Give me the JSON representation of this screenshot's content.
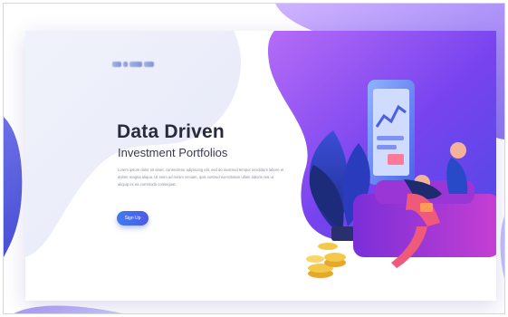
{
  "page": {
    "title": "Data Driven",
    "subtitle": "Investment Portfolios",
    "description": "Lorem ipsum dolor sit amet, consectetur adipiscing elit, sed do eiusmod tempor incididunt labore et dolore magna aliqua. Ut enim ad minim veniam, quis nostrud exercitation ullam laboris nisi ut aliquip ex ea commodo consequat.",
    "signup_label": "Sign Up"
  },
  "colors": {
    "accent_blue": "#3e7bf0",
    "accent_purple": "#7b3ff0",
    "accent_pink": "#d83fd0",
    "heading": "#2a2a3d"
  },
  "illustration": {
    "icons": [
      "plant-icon",
      "phone-icon",
      "person-icon",
      "sofa-icon",
      "coins-icon",
      "chart-icon"
    ]
  }
}
